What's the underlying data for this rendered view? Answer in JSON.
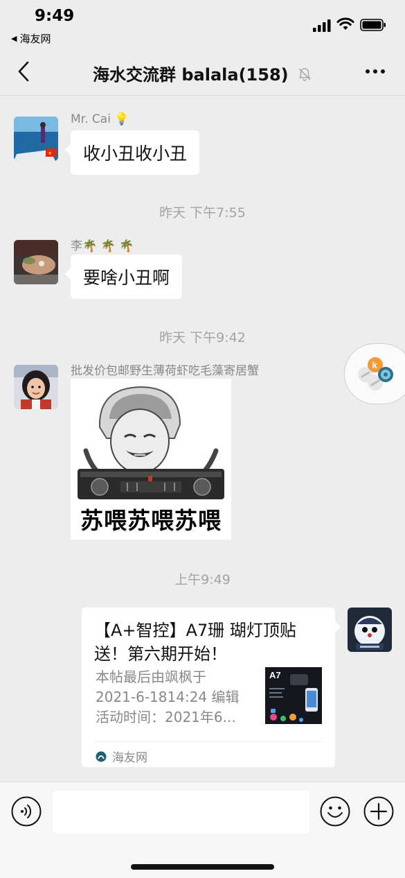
{
  "status_bar": {
    "time": "9:49",
    "back_app": "海友网"
  },
  "nav": {
    "title": "海水交流群 balala(158)",
    "icons": [
      "back-icon",
      "mute-bell-icon",
      "more-icon"
    ]
  },
  "messages": [
    {
      "sender": "Mr. Cai 💡",
      "text": "收小丑收小丑"
    },
    {
      "timestamp": "昨天 下午7:55"
    },
    {
      "sender": "李🌴 🌴 🌴",
      "text": "要啥小丑啊"
    },
    {
      "timestamp": "昨天 下午9:42"
    },
    {
      "sender": "批发价包邮野生薄荷虾吃毛藻寄居蟹",
      "sticker_caption": "苏喂苏喂苏喂"
    },
    {
      "timestamp": "上午9:49"
    }
  ],
  "card": {
    "title": "【A+智控】A7珊 瑚灯顶贴送！第六期开始！",
    "desc_lines": [
      "本帖最后由飒枫于",
      "2021-6-1814:24 编辑",
      "活动时间：2021年6..."
    ],
    "thumb_label": "A7",
    "source": "海友网"
  },
  "colors": {
    "background": "#ededed",
    "bubble": "#ffffff",
    "secondary_text": "#888888",
    "timestamp_text": "#a3a3a3"
  }
}
